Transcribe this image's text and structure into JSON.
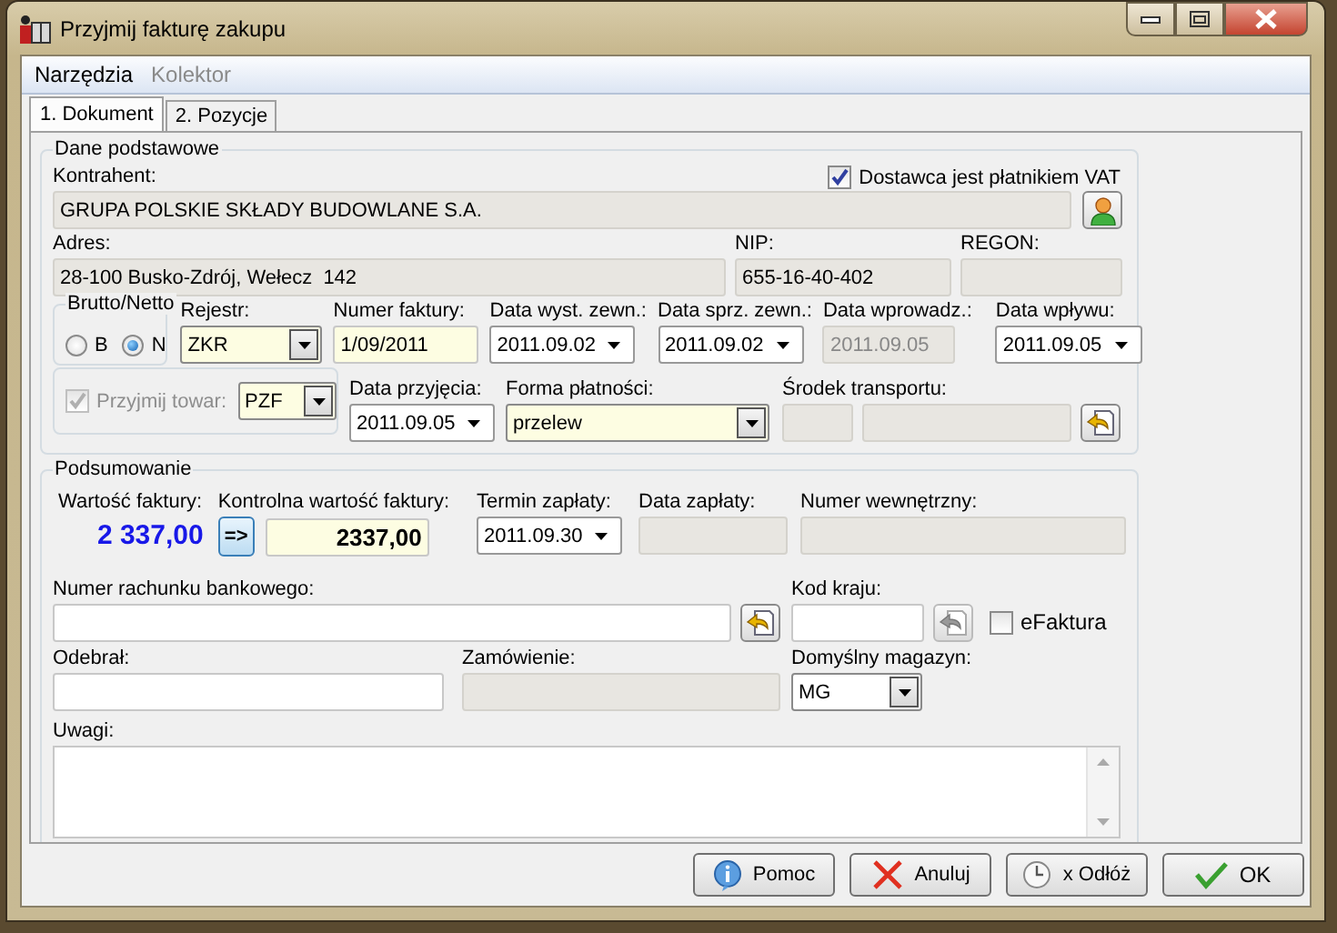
{
  "window": {
    "title": "Przyjmij fakturę zakupu"
  },
  "menu": [
    {
      "label": "Narzędzia",
      "disabled": false
    },
    {
      "label": "Kolektor",
      "disabled": true
    }
  ],
  "tabs": [
    {
      "label": "1. Dokument",
      "selected": true
    },
    {
      "label": "2. Pozycje",
      "selected": false
    }
  ],
  "basic": {
    "title": "Dane podstawowe",
    "contractor": {
      "label": "Kontrahent:",
      "value": "GRUPA POLSKIE SKŁADY BUDOWLANE S.A."
    },
    "vat_payer": {
      "label": "Dostawca jest płatnikiem VAT",
      "checked": true
    },
    "address": {
      "label": "Adres:",
      "value": "28-100 Busko-Zdrój, Wełecz  142"
    },
    "nip": {
      "label": "NIP:",
      "value": "655-16-40-402"
    },
    "regon": {
      "label": "REGON:"
    },
    "gross_net": {
      "title": "Brutto/Netto",
      "options": [
        {
          "label": "B",
          "selected": false
        },
        {
          "label": "N",
          "selected": true
        }
      ]
    },
    "fields": [
      {
        "kind": "combo",
        "label": "Rejestr:",
        "value": "ZKR",
        "highlighted": true,
        "disabled": false
      },
      {
        "kind": "text",
        "label": "Numer faktury:",
        "value": "1/09/2011",
        "highlighted": true,
        "disabled": false
      },
      {
        "kind": "date",
        "label": "Data wyst. zewn.:",
        "value": "2011.09.02",
        "highlighted": false,
        "disabled": false
      },
      {
        "kind": "date",
        "label": "Data sprz. zewn.:",
        "value": "2011.09.02",
        "highlighted": false,
        "disabled": false
      },
      {
        "kind": "text",
        "label": "Data wprowadz.:",
        "value": "2011.09.05",
        "highlighted": false,
        "disabled": true
      },
      {
        "kind": "date",
        "label": "Data wpływu:",
        "value": "2011.09.05",
        "highlighted": false,
        "disabled": false
      }
    ],
    "receive_goods": {
      "label": "Przyjmij towar:",
      "checked": true,
      "disabled": true,
      "value": "PZF"
    },
    "fields2": [
      {
        "kind": "date",
        "label": "Data przyjęcia:",
        "value": "2011.09.05",
        "highlighted": false,
        "disabled": false
      },
      {
        "kind": "combo",
        "label": "Forma płatności:",
        "value": "przelew",
        "highlighted": true,
        "disabled": false
      }
    ],
    "transport": {
      "label": "Środek transportu:"
    }
  },
  "summary": {
    "title": "Podsumowanie",
    "invoice_value": {
      "label": "Wartość faktury:",
      "value": "2 337,00"
    },
    "control_value": {
      "label": "Kontrolna wartość faktury:",
      "button": "=>",
      "value": "2337,00"
    },
    "payment_due": {
      "label": "Termin zapłaty:",
      "value": "2011.09.30"
    },
    "payment_date": {
      "label": "Data zapłaty:"
    },
    "internal_number": {
      "label": "Numer wewnętrzny:"
    },
    "bank_account": {
      "label": "Numer rachunku bankowego:"
    },
    "country_code": {
      "label": "Kod kraju:"
    },
    "efaktura": {
      "label": "eFaktura",
      "checked": false
    },
    "received_by": {
      "label": "Odebrał:"
    },
    "order": {
      "label": "Zamówienie:"
    },
    "warehouse": {
      "label": "Domyślny magazyn:",
      "value": "MG"
    },
    "notes": {
      "label": "Uwagi:"
    }
  },
  "buttons": [
    {
      "label": "Pomoc",
      "kind": "help"
    },
    {
      "label": "Anuluj",
      "kind": "cancel"
    },
    {
      "label": "x Odłóż",
      "kind": "postpone"
    },
    {
      "label": "OK",
      "kind": "ok"
    }
  ]
}
